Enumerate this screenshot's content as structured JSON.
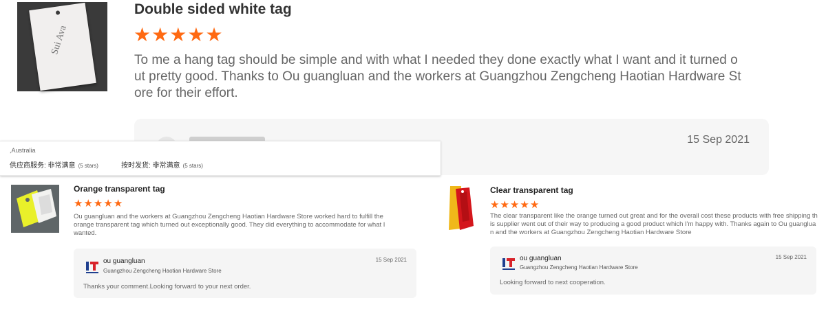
{
  "top_review": {
    "thumbnail_text": "Sui Ava",
    "title": "Double sided white tag",
    "rating": 5,
    "body": "To me a hang tag should be simple and with what I needed they done exactly what I want and it turned out pretty good. Thanks to Ou guangluan and the workers at Guangzhou Zengcheng Haotian Hardware Store for their effort.",
    "reply_date": "15 Sep 2021"
  },
  "reviewer_panel": {
    "country": ",Australia",
    "service_label": "供应商服务: 非常满意",
    "service_note": "(5 stars)",
    "shipping_label": "按时发货: 非常满意",
    "shipping_note": "(5 stars)"
  },
  "reviews": [
    {
      "title": "Orange transparent tag",
      "rating": 5,
      "body": "Ou guangluan and the workers at Guangzhou Zengcheng Haotian Hardware Store worked hard to fulfill the orange transparent tag which turned out exceptionally good. They did everything to accommodate for what I wanted.",
      "reply": {
        "name": "ou guangluan",
        "store": "Guangzhou Zengcheng Haotian Hardware Store",
        "date": "15 Sep 2021",
        "text": "Thanks your comment.Looking forward to your next order."
      }
    },
    {
      "title": "Clear transparent tag",
      "rating": 5,
      "body": "The clear transparent like the orange turned out great and for the overall  cost these products with free shipping this supplier went out of their way to producing a good product which I'm happy with. Thanks again to Ou guangluan and the workers at Guangzhou Zengcheng Haotian Hardware Store",
      "reply": {
        "name": "ou guangluan",
        "store": "Guangzhou Zengcheng Haotian Hardware Store",
        "date": "15 Sep 2021",
        "text": "Looking forward to next cooperation."
      }
    }
  ],
  "icons": {
    "star": "star-icon",
    "store_logo": "store-logo-icon"
  },
  "colors": {
    "star": "#ff6a13",
    "logo_blue": "#1f3f8f",
    "logo_red": "#d8232a"
  }
}
